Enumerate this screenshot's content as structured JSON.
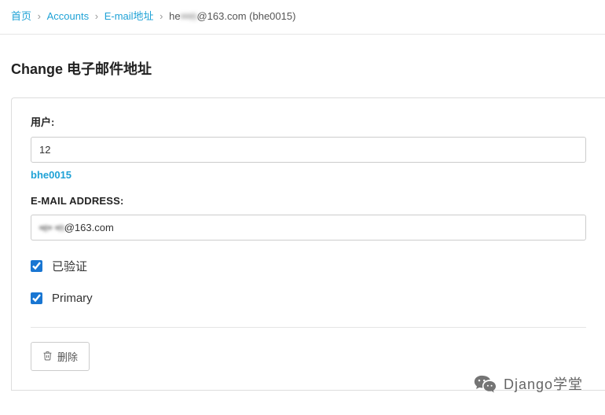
{
  "breadcrumb": {
    "home": "首页",
    "accounts": "Accounts",
    "email_list": "E-mail地址",
    "current_prefix": "he",
    "current_blurred": "•••n",
    "current_suffix": "@163.com (bhe0015)"
  },
  "page_title": "Change 电子邮件地址",
  "form": {
    "user_label": "用户:",
    "user_value": "12",
    "user_helper": "bhe0015",
    "email_label": "E-mail address:",
    "email_value_blurred": "•e• •n",
    "email_value_suffix": "@163.com",
    "verified_label": "已验证",
    "primary_label": "Primary"
  },
  "actions": {
    "delete_label": "删除"
  },
  "watermark": {
    "text": "Django学堂"
  }
}
